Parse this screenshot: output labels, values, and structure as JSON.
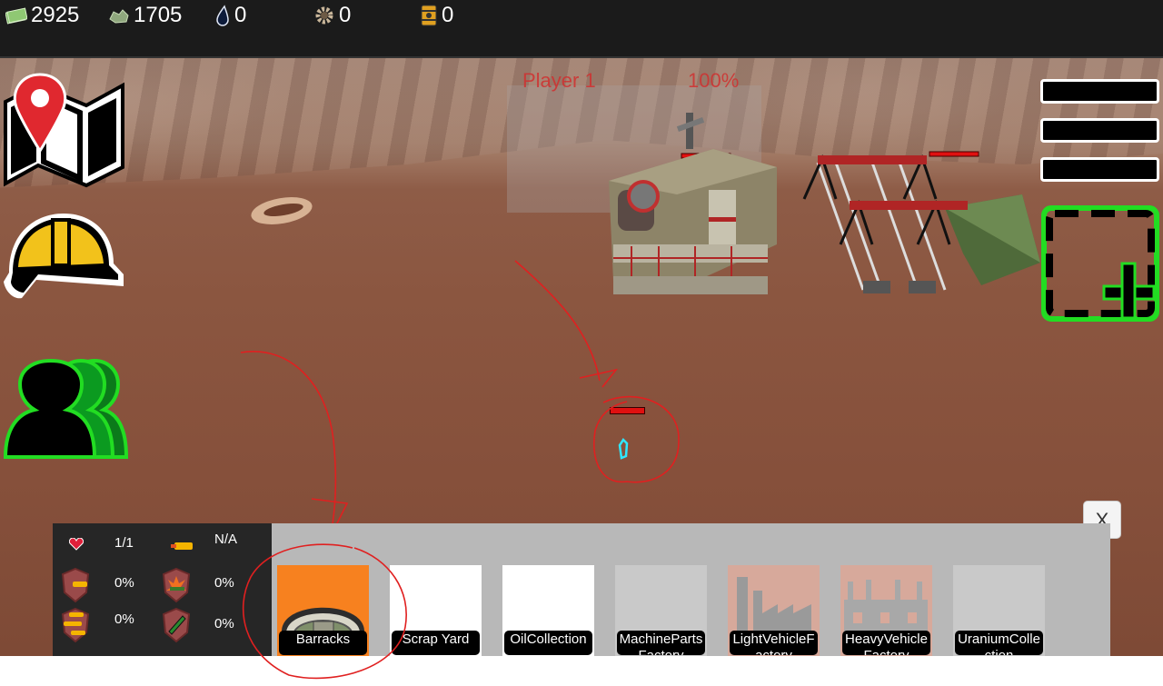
{
  "resources": [
    {
      "name": "money",
      "value": "2925",
      "icon": "cash-icon"
    },
    {
      "name": "scrap",
      "value": "1705",
      "icon": "scrap-icon"
    },
    {
      "name": "oil",
      "value": "0",
      "icon": "oil-drop-icon"
    },
    {
      "name": "machine_parts",
      "value": "0",
      "icon": "gear-icon"
    },
    {
      "name": "uranium",
      "value": "0",
      "icon": "uranium-barrel-icon"
    }
  ],
  "scene": {
    "player_label": "Player 1",
    "player_progress": "100%"
  },
  "side_buttons": {
    "map": "map-icon",
    "build": "hard-hat-icon",
    "units": "group-icon",
    "select": "add-selection-icon"
  },
  "stats": {
    "health": "1/1",
    "attack_range": "N/A",
    "armor": "0%",
    "explosive_resist": "0%",
    "ammo": "0%",
    "rocket_resist": "0%"
  },
  "buildings": [
    {
      "label": "Barracks",
      "state": "selected"
    },
    {
      "label": "Scrap Yard",
      "state": "available"
    },
    {
      "label": "OilCollection",
      "state": "available"
    },
    {
      "label": "MachineParts Factory",
      "state": "locked"
    },
    {
      "label": "LightVehicleF actory",
      "state": "locked"
    },
    {
      "label": "HeavyVehicle Factory",
      "state": "locked"
    },
    {
      "label": "UraniumColle ction",
      "state": "locked"
    }
  ],
  "close_label": "X",
  "colors": {
    "topbar": "#1b1b1b",
    "accent_orange": "#f7811f",
    "health_red": "#e01010",
    "select_green": "#22dd22",
    "annotation_red": "#e02020"
  }
}
